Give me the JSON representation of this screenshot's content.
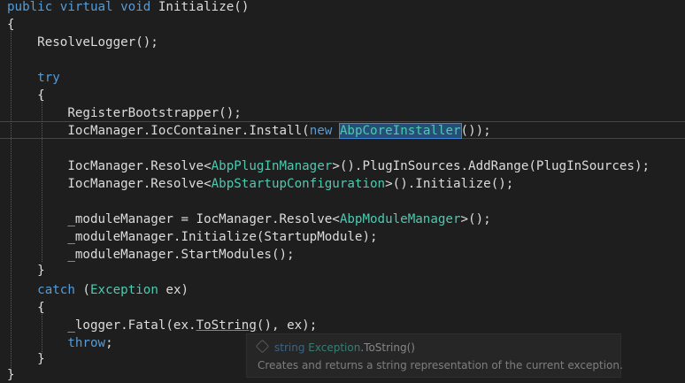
{
  "code": {
    "l1": {
      "kw1": "public",
      "kw2": "virtual",
      "kw3": "void",
      "name": "Initialize",
      "rest": "()"
    },
    "l2": {
      "text": "{"
    },
    "l3": {
      "text": "ResolveLogger();"
    },
    "l4": {
      "kw": "try"
    },
    "l5": {
      "text": "{"
    },
    "l6": {
      "text": "RegisterBootstrapper();"
    },
    "l7": {
      "pre": "IocManager.IocContainer.Install(",
      "kw": "new",
      "type": "AbpCoreInstaller",
      "post": "());"
    },
    "l8": {
      "pre": "IocManager.Resolve<",
      "type": "AbpPlugInManager",
      "post": ">().PlugInSources.AddRange(PlugInSources);"
    },
    "l9": {
      "pre": "IocManager.Resolve<",
      "type": "AbpStartupConfiguration",
      "post": ">().Initialize();"
    },
    "l10": {
      "pre": "_moduleManager = IocManager.Resolve<",
      "type": "AbpModuleManager",
      "post": ">();"
    },
    "l11": {
      "text": "_moduleManager.Initialize(StartupModule);"
    },
    "l12": {
      "text": "_moduleManager.StartModules();"
    },
    "l13": {
      "text": "}"
    },
    "l14": {
      "kw": "catch",
      "open": " (",
      "type": "Exception",
      "post": " ex)"
    },
    "l15": {
      "text": "{"
    },
    "l16": {
      "pre": "_logger.Fatal(ex.",
      "method": "ToString",
      "post": "(), ex);"
    },
    "l17": {
      "kw": "throw",
      "post": ";"
    },
    "l18": {
      "text": "}"
    },
    "l19": {
      "text": "}"
    }
  },
  "tooltip": {
    "icon": "method-icon",
    "return_type": "string",
    "class_name": "Exception",
    "member": ".ToString()",
    "description": "Creates and returns a string representation of the current exception."
  },
  "colors": {
    "background": "#1e1e1e",
    "keyword": "#569cd6",
    "type": "#4ec9b0",
    "identifier": "#dcdcdc",
    "selection": "#264f78"
  }
}
